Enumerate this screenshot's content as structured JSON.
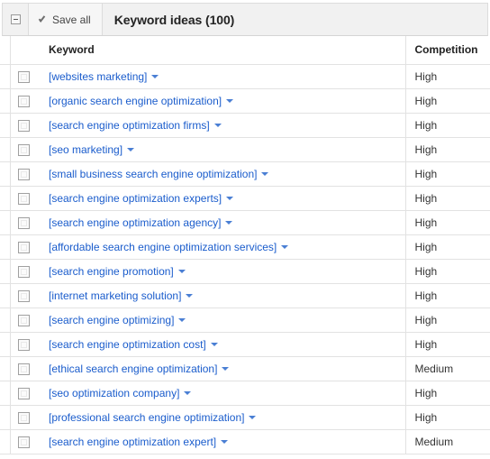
{
  "toolbar": {
    "collapse_icon": "minus-box-icon",
    "save_all_label": "Save all",
    "save_all_icon": "checkmark-icon",
    "title": "Keyword ideas (100)"
  },
  "table": {
    "columns": {
      "keyword": "Keyword",
      "competition": "Competition"
    },
    "rows": [
      {
        "keyword": "[websites marketing]",
        "competition": "High"
      },
      {
        "keyword": "[organic search engine optimization]",
        "competition": "High"
      },
      {
        "keyword": "[search engine optimization firms]",
        "competition": "High"
      },
      {
        "keyword": "[seo marketing]",
        "competition": "High"
      },
      {
        "keyword": "[small business search engine optimization]",
        "competition": "High"
      },
      {
        "keyword": "[search engine optimization experts]",
        "competition": "High"
      },
      {
        "keyword": "[search engine optimization agency]",
        "competition": "High"
      },
      {
        "keyword": "[affordable search engine optimization services]",
        "competition": "High"
      },
      {
        "keyword": "[search engine promotion]",
        "competition": "High"
      },
      {
        "keyword": "[internet marketing solution]",
        "competition": "High"
      },
      {
        "keyword": "[search engine optimizing]",
        "competition": "High"
      },
      {
        "keyword": "[search engine optimization cost]",
        "competition": "High"
      },
      {
        "keyword": "[ethical search engine optimization]",
        "competition": "Medium"
      },
      {
        "keyword": "[seo optimization company]",
        "competition": "High"
      },
      {
        "keyword": "[professional search engine optimization]",
        "competition": "High"
      },
      {
        "keyword": "[search engine optimization expert]",
        "competition": "Medium"
      }
    ]
  },
  "colors": {
    "link": "#1a5ccc",
    "caret": "#4a7fd4",
    "toolbar_bg": "#f1f1f1",
    "row_border": "#e2e2e2"
  }
}
